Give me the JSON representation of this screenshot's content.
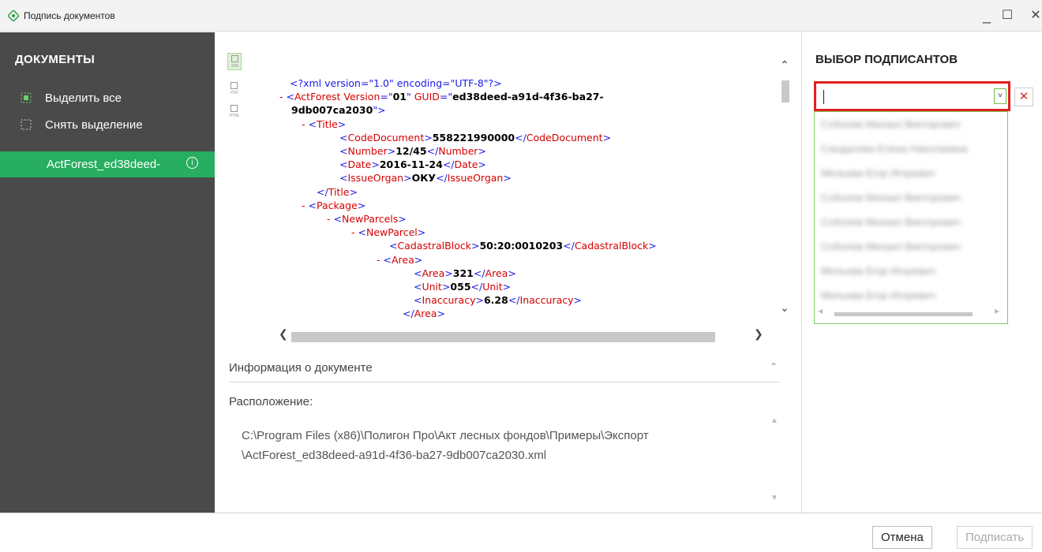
{
  "window": {
    "title": "Подпись документов",
    "minimize": "_",
    "maximize": "☐",
    "close": "✕"
  },
  "sidebar": {
    "title": "ДОКУМЕНТЫ",
    "select_all": "Выделить все",
    "deselect": "Снять выделение",
    "document": "ActForest_ed38deed-",
    "info_icon": "i"
  },
  "viewer": {
    "formats": [
      "XML",
      "PDF",
      "HTML"
    ],
    "active_format": "XML",
    "lines": [
      [
        [
          "plain",
          "<?xml version=\"1.0\" encoding=\"UTF-8\"?>"
        ]
      ],
      [
        [
          "minus",
          "- "
        ],
        [
          "tag",
          "<"
        ],
        [
          "attr",
          "ActForest Version"
        ],
        [
          "tag",
          "=\""
        ],
        [
          "val",
          "01"
        ],
        [
          "tag",
          "\" "
        ],
        [
          "attr",
          "GUID"
        ],
        [
          "tag",
          "=\""
        ],
        [
          "val",
          "ed38deed-a91d-4f36-ba27-"
        ]
      ],
      [
        [
          "val",
          "9db007ca2030"
        ],
        [
          "tag",
          "\">"
        ]
      ],
      [
        [
          "minus",
          "- "
        ],
        [
          "tag",
          "<"
        ],
        [
          "attr",
          "Title"
        ],
        [
          "tag",
          ">"
        ]
      ],
      [
        [
          "tag",
          "<"
        ],
        [
          "attr",
          "CodeDocument"
        ],
        [
          "tag",
          ">"
        ],
        [
          "val",
          "558221990000"
        ],
        [
          "tag",
          "</"
        ],
        [
          "attr",
          "CodeDocument"
        ],
        [
          "tag",
          ">"
        ]
      ],
      [
        [
          "tag",
          "<"
        ],
        [
          "attr",
          "Number"
        ],
        [
          "tag",
          ">"
        ],
        [
          "val",
          "12/45"
        ],
        [
          "tag",
          "</"
        ],
        [
          "attr",
          "Number"
        ],
        [
          "tag",
          ">"
        ]
      ],
      [
        [
          "tag",
          "<"
        ],
        [
          "attr",
          "Date"
        ],
        [
          "tag",
          ">"
        ],
        [
          "val",
          "2016-11-24"
        ],
        [
          "tag",
          "</"
        ],
        [
          "attr",
          "Date"
        ],
        [
          "tag",
          ">"
        ]
      ],
      [
        [
          "tag",
          "<"
        ],
        [
          "attr",
          "IssueOrgan"
        ],
        [
          "tag",
          ">"
        ],
        [
          "val",
          "ОКУ"
        ],
        [
          "tag",
          "</"
        ],
        [
          "attr",
          "IssueOrgan"
        ],
        [
          "tag",
          ">"
        ]
      ],
      [
        [
          "tag",
          "</"
        ],
        [
          "attr",
          "Title"
        ],
        [
          "tag",
          ">"
        ]
      ],
      [
        [
          "minus",
          "- "
        ],
        [
          "tag",
          "<"
        ],
        [
          "attr",
          "Package"
        ],
        [
          "tag",
          ">"
        ]
      ],
      [
        [
          "minus",
          "- "
        ],
        [
          "tag",
          "<"
        ],
        [
          "attr",
          "NewParcels"
        ],
        [
          "tag",
          ">"
        ]
      ],
      [
        [
          "minus",
          "- "
        ],
        [
          "tag",
          "<"
        ],
        [
          "attr",
          "NewParcel"
        ],
        [
          "tag",
          ">"
        ]
      ],
      [
        [
          "tag",
          "<"
        ],
        [
          "attr",
          "CadastralBlock"
        ],
        [
          "tag",
          ">"
        ],
        [
          "val",
          "50:20:0010203"
        ],
        [
          "tag",
          "</"
        ],
        [
          "attr",
          "CadastralBlock"
        ],
        [
          "tag",
          ">"
        ]
      ],
      [
        [
          "minus",
          "- "
        ],
        [
          "tag",
          "<"
        ],
        [
          "attr",
          "Area"
        ],
        [
          "tag",
          ">"
        ]
      ],
      [
        [
          "tag",
          "<"
        ],
        [
          "attr",
          "Area"
        ],
        [
          "tag",
          ">"
        ],
        [
          "val",
          "321"
        ],
        [
          "tag",
          "</"
        ],
        [
          "attr",
          "Area"
        ],
        [
          "tag",
          ">"
        ]
      ],
      [
        [
          "tag",
          "<"
        ],
        [
          "attr",
          "Unit"
        ],
        [
          "tag",
          ">"
        ],
        [
          "val",
          "055"
        ],
        [
          "tag",
          "</"
        ],
        [
          "attr",
          "Unit"
        ],
        [
          "tag",
          ">"
        ]
      ],
      [
        [
          "tag",
          "<"
        ],
        [
          "attr",
          "Inaccuracy"
        ],
        [
          "tag",
          ">"
        ],
        [
          "val",
          "6.28"
        ],
        [
          "tag",
          "</"
        ],
        [
          "attr",
          "Inaccuracy"
        ],
        [
          "tag",
          ">"
        ]
      ],
      [
        [
          "tag",
          "</"
        ],
        [
          "attr",
          "Area"
        ],
        [
          "tag",
          ">"
        ]
      ]
    ]
  },
  "doc_info": {
    "title": "Информация о документе",
    "location_label": "Расположение:",
    "location_line1": "C:\\Program Files (x86)\\Полигон Про\\Акт лесных фондов\\Примеры\\Экспорт",
    "location_line2": "\\ActForest_ed38deed-a91d-4f36-ba27-9db007ca2030.xml"
  },
  "signers": {
    "title": "ВЫБОР ПОДПИСАНТОВ",
    "input_value": "",
    "dropdown_arrow": "˅",
    "clear_icon": "✕",
    "options": [
      "Соболев Михаил Викторович",
      "Сандалова Елена Николаевна",
      "Мельева Егор Игоревич",
      "Соболев Михаил Викторович",
      "Соболев Михаил Викторович",
      "Соболев Михаил Викторович",
      "Мельева Егор Игоревич",
      "Мельева Егор Игоревич"
    ]
  },
  "footer": {
    "cancel": "Отмена",
    "sign": "Подписать"
  },
  "colors": {
    "sidebar_bg": "#4a4a4a",
    "accent_green": "#27ae60",
    "highlight_red": "#e02020",
    "xml_tag": "#1a1ae6",
    "xml_attr": "#d60000"
  }
}
